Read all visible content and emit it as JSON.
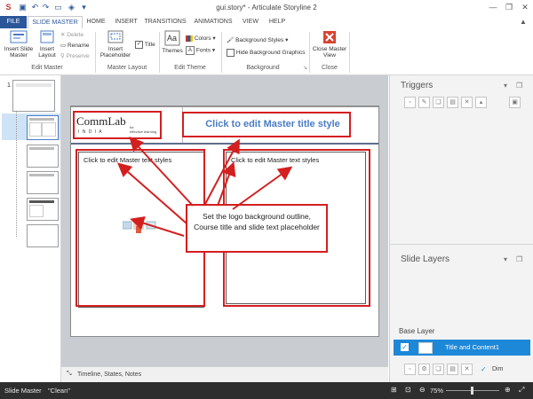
{
  "app": {
    "window_title": "gui.story* - Articulate Storyline 2"
  },
  "tabs": [
    {
      "label": "FILE"
    },
    {
      "label": "SLIDE MASTER"
    },
    {
      "label": "HOME"
    },
    {
      "label": "INSERT"
    },
    {
      "label": "TRANSITIONS"
    },
    {
      "label": "ANIMATIONS"
    },
    {
      "label": "VIEW"
    },
    {
      "label": "HELP"
    }
  ],
  "ribbon": {
    "edit_master": {
      "label": "Edit Master",
      "insert_slide_master": "Insert Slide Master",
      "insert_layout": "Insert Layout",
      "delete": "Delete",
      "rename": "Rename",
      "preserve": "Preserve"
    },
    "master_layout": {
      "label": "Master Layout",
      "insert_placeholder": "Insert Placeholder",
      "title_checkbox": "Title"
    },
    "edit_theme": {
      "label": "Edit Theme",
      "themes": "Themes",
      "colors": "Colors",
      "fonts": "Fonts"
    },
    "background": {
      "label": "Background",
      "background_styles": "Background Styles",
      "hide_background_graphics": "Hide Background Graphics"
    },
    "close": {
      "label": "Close",
      "close_master_view": "Close Master View"
    }
  },
  "slide": {
    "title_placeholder": "Click to edit Master title style",
    "text_placeholder_left": "Click to edit Master text styles",
    "text_placeholder_right": "Click to edit Master text styles",
    "logo": {
      "main": "CommLab",
      "sub": "I N D I A",
      "tag1": "for",
      "tag2": "effective learning"
    },
    "callout": "Set the logo background outline, Course title and slide text placeholder"
  },
  "slide_number": "1",
  "timeline_label": "Timeline, States, Notes",
  "triggers": {
    "title": "Triggers"
  },
  "slide_layers": {
    "title": "Slide Layers",
    "base_layer_label": "Base Layer",
    "layer_name": "Title and Content1",
    "dim_label": "Dim"
  },
  "status": {
    "mode": "Slide Master",
    "theme": "\"Clean\"",
    "zoom": "75%"
  },
  "colors": {
    "accent": "#2b579a",
    "annotation_red": "#d41f1f",
    "title_blue": "#4a7cc4",
    "layer_selected": "#1e88d8"
  }
}
